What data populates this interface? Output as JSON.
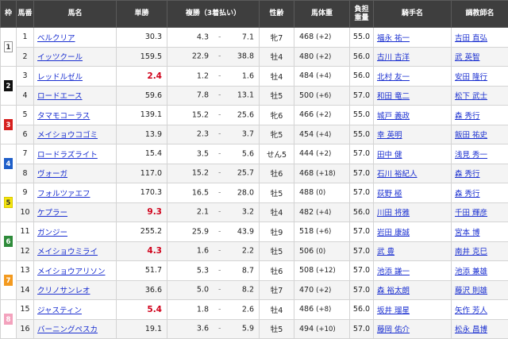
{
  "headers": {
    "waku": "枠",
    "umaban": "馬番",
    "name": "馬名",
    "win": "単勝",
    "place": "複勝（3着払い）",
    "sexage": "性齢",
    "weight": "馬体重",
    "burden_line1": "負担",
    "burden_line2": "重量",
    "jockey": "騎手名",
    "trainer": "調教師名"
  },
  "frames": [
    {
      "label": "1",
      "bg": "#ffffff",
      "fg": "#333333",
      "border": "#999999"
    },
    {
      "label": "2",
      "bg": "#111111",
      "fg": "#ffffff",
      "border": "#111111"
    },
    {
      "label": "3",
      "bg": "#d6201f",
      "fg": "#ffffff",
      "border": "#d6201f"
    },
    {
      "label": "4",
      "bg": "#1f5fc9",
      "fg": "#ffffff",
      "border": "#1f5fc9"
    },
    {
      "label": "5",
      "bg": "#f5e60f",
      "fg": "#333333",
      "border": "#d8c800"
    },
    {
      "label": "6",
      "bg": "#2e8b3a",
      "fg": "#ffffff",
      "border": "#2e8b3a"
    },
    {
      "label": "7",
      "bg": "#f39a1f",
      "fg": "#ffffff",
      "border": "#f39a1f"
    },
    {
      "label": "8",
      "bg": "#f3a2bd",
      "fg": "#ffffff",
      "border": "#f3a2bd"
    }
  ],
  "rows": [
    {
      "num": "1",
      "name": "ベルクリア",
      "win": "30.3",
      "win_fav": false,
      "place_lo": "4.3",
      "place_dash": "-",
      "place_hi": "7.1",
      "sexage": "牝7",
      "weight": "468",
      "weight_diff": "(+2)",
      "burden": "55.0",
      "jockey": "福永 祐一",
      "trainer": "吉田 直弘"
    },
    {
      "num": "2",
      "name": "イッツクール",
      "win": "159.5",
      "win_fav": false,
      "place_lo": "22.9",
      "place_dash": "-",
      "place_hi": "38.8",
      "sexage": "牡4",
      "weight": "480",
      "weight_diff": "(+2)",
      "burden": "56.0",
      "jockey": "古川 吉洋",
      "trainer": "武 英智"
    },
    {
      "num": "3",
      "name": "レッドルゼル",
      "win": "2.4",
      "win_fav": true,
      "place_lo": "1.2",
      "place_dash": "-",
      "place_hi": "1.6",
      "sexage": "牡4",
      "weight": "484",
      "weight_diff": "(+4)",
      "burden": "56.0",
      "jockey": "北村 友一",
      "trainer": "安田 隆行"
    },
    {
      "num": "4",
      "name": "ロードエース",
      "win": "59.6",
      "win_fav": false,
      "place_lo": "7.8",
      "place_dash": "-",
      "place_hi": "13.1",
      "sexage": "牡5",
      "weight": "500",
      "weight_diff": "(+6)",
      "burden": "57.0",
      "jockey": "和田 竜二",
      "trainer": "松下 武士"
    },
    {
      "num": "5",
      "name": "タマモコーラス",
      "win": "139.1",
      "win_fav": false,
      "place_lo": "15.2",
      "place_dash": "-",
      "place_hi": "25.6",
      "sexage": "牝6",
      "weight": "466",
      "weight_diff": "(+2)",
      "burden": "55.0",
      "jockey": "城戸 義政",
      "trainer": "森 秀行"
    },
    {
      "num": "6",
      "name": "メイショウコゴミ",
      "win": "13.9",
      "win_fav": false,
      "place_lo": "2.3",
      "place_dash": "-",
      "place_hi": "3.7",
      "sexage": "牝5",
      "weight": "454",
      "weight_diff": "(+4)",
      "burden": "55.0",
      "jockey": "幸 英明",
      "trainer": "飯田 祐史"
    },
    {
      "num": "7",
      "name": "ロードラズライト",
      "win": "15.4",
      "win_fav": false,
      "place_lo": "3.5",
      "place_dash": "-",
      "place_hi": "5.6",
      "sexage": "せん5",
      "weight": "444",
      "weight_diff": "(+2)",
      "burden": "57.0",
      "jockey": "田中 健",
      "trainer": "浅見 秀一"
    },
    {
      "num": "8",
      "name": "ヴォーガ",
      "win": "117.0",
      "win_fav": false,
      "place_lo": "15.2",
      "place_dash": "-",
      "place_hi": "25.7",
      "sexage": "牡6",
      "weight": "468",
      "weight_diff": "(+18)",
      "burden": "57.0",
      "jockey": "石川 裕紀人",
      "trainer": "森 秀行"
    },
    {
      "num": "9",
      "name": "フォルツァエフ",
      "win": "170.3",
      "win_fav": false,
      "place_lo": "16.5",
      "place_dash": "-",
      "place_hi": "28.0",
      "sexage": "牡5",
      "weight": "488",
      "weight_diff": "(0)",
      "burden": "57.0",
      "jockey": "荻野 極",
      "trainer": "森 秀行"
    },
    {
      "num": "10",
      "name": "ケプラー",
      "win": "9.3",
      "win_fav": true,
      "place_lo": "2.1",
      "place_dash": "-",
      "place_hi": "3.2",
      "sexage": "牡4",
      "weight": "482",
      "weight_diff": "(+4)",
      "burden": "56.0",
      "jockey": "川田 将雅",
      "trainer": "千田 輝彦"
    },
    {
      "num": "11",
      "name": "ガンジー",
      "win": "255.2",
      "win_fav": false,
      "place_lo": "25.9",
      "place_dash": "-",
      "place_hi": "43.9",
      "sexage": "牡9",
      "weight": "518",
      "weight_diff": "(+6)",
      "burden": "57.0",
      "jockey": "岩田 康誠",
      "trainer": "宮本 博"
    },
    {
      "num": "12",
      "name": "メイショウミライ",
      "win": "4.3",
      "win_fav": true,
      "place_lo": "1.6",
      "place_dash": "-",
      "place_hi": "2.2",
      "sexage": "牡5",
      "weight": "506",
      "weight_diff": "(0)",
      "burden": "57.0",
      "jockey": "武 豊",
      "trainer": "南井 克巳"
    },
    {
      "num": "13",
      "name": "メイショウアリソン",
      "win": "51.7",
      "win_fav": false,
      "place_lo": "5.3",
      "place_dash": "-",
      "place_hi": "8.7",
      "sexage": "牡6",
      "weight": "508",
      "weight_diff": "(+12)",
      "burden": "57.0",
      "jockey": "池添 謙一",
      "trainer": "池添 兼雄"
    },
    {
      "num": "14",
      "name": "クリノサンレオ",
      "win": "36.6",
      "win_fav": false,
      "place_lo": "5.0",
      "place_dash": "-",
      "place_hi": "8.2",
      "sexage": "牡7",
      "weight": "470",
      "weight_diff": "(+2)",
      "burden": "57.0",
      "jockey": "森 裕太朗",
      "trainer": "藤沢 則雄"
    },
    {
      "num": "15",
      "name": "ジャスティン",
      "win": "5.4",
      "win_fav": true,
      "place_lo": "1.8",
      "place_dash": "-",
      "place_hi": "2.6",
      "sexage": "牡4",
      "weight": "486",
      "weight_diff": "(+8)",
      "burden": "56.0",
      "jockey": "坂井 瑠星",
      "trainer": "矢作 芳人"
    },
    {
      "num": "16",
      "name": "バーニングペスカ",
      "win": "19.1",
      "win_fav": false,
      "place_lo": "3.6",
      "place_dash": "-",
      "place_hi": "5.9",
      "sexage": "牡5",
      "weight": "494",
      "weight_diff": "(+10)",
      "burden": "57.0",
      "jockey": "藤岡 佑介",
      "trainer": "松永 昌博"
    }
  ]
}
